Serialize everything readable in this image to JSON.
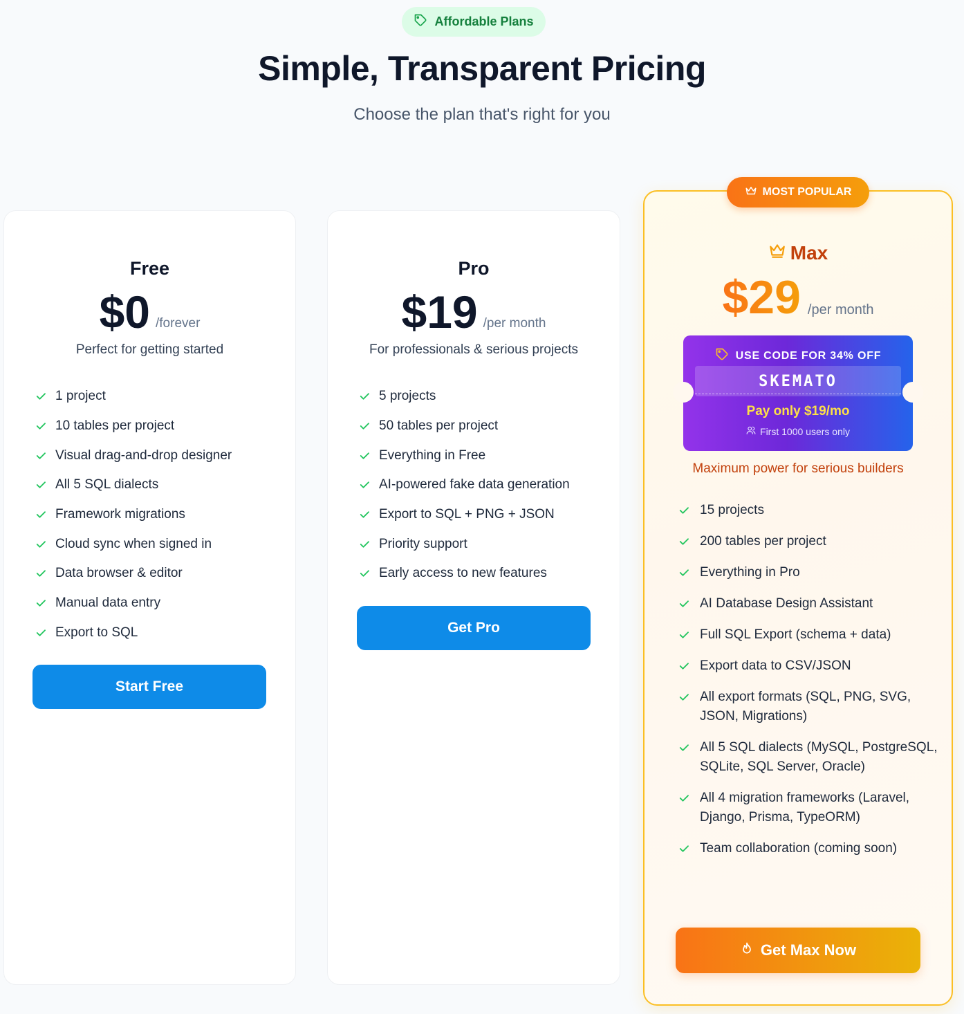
{
  "header": {
    "badge": "Affordable Plans",
    "title": "Simple, Transparent Pricing",
    "subtitle": "Choose the plan that's right for you"
  },
  "colors": {
    "accent_green": "#22c55e",
    "button_blue": "#0e8be8",
    "max_orange": "#f97316",
    "max_gold": "#f59e0b",
    "coupon_purple": "#9333ea",
    "coupon_blue": "#2563eb"
  },
  "plans": [
    {
      "name": "Free",
      "price": "$0",
      "period": "/forever",
      "description": "Perfect for getting started",
      "features": [
        "1 project",
        "10 tables per project",
        "Visual drag-and-drop designer",
        "All 5 SQL dialects",
        "Framework migrations",
        "Cloud sync when signed in",
        "Data browser & editor",
        "Manual data entry",
        "Export to SQL"
      ],
      "button": "Start Free"
    },
    {
      "name": "Pro",
      "price": "$19",
      "period": "/per month",
      "description": "For professionals & serious projects",
      "features": [
        "5 projects",
        "50 tables per project",
        "Everything in Free",
        "AI-powered fake data generation",
        "Export to SQL + PNG + JSON",
        "Priority support",
        "Early access to new features"
      ],
      "button": "Get Pro"
    },
    {
      "name": "Max",
      "badge": "MOST POPULAR",
      "price": "$29",
      "period": "/per month",
      "coupon": {
        "headline": "USE CODE FOR 34% OFF",
        "code": "SKEMATO",
        "pay_only": "Pay only $19/mo",
        "note": "First 1000 users only"
      },
      "description": "Maximum power for serious builders",
      "features": [
        "15 projects",
        "200 tables per project",
        "Everything in Pro",
        "AI Database Design Assistant",
        "Full SQL Export (schema + data)",
        "Export data to CSV/JSON",
        "All export formats (SQL, PNG, SVG, JSON, Migrations)",
        "All 5 SQL dialects (MySQL, PostgreSQL, SQLite, SQL Server, Oracle)",
        "All 4 migration frameworks (Laravel, Django, Prisma, TypeORM)",
        "Team collaboration (coming soon)"
      ],
      "button": "Get Max Now"
    }
  ],
  "icons": {
    "badge": "tag-icon",
    "popular": "crown-icon",
    "coupon": "tag-icon",
    "note": "users-icon",
    "max_button": "flame-icon",
    "feature": "check-icon"
  }
}
